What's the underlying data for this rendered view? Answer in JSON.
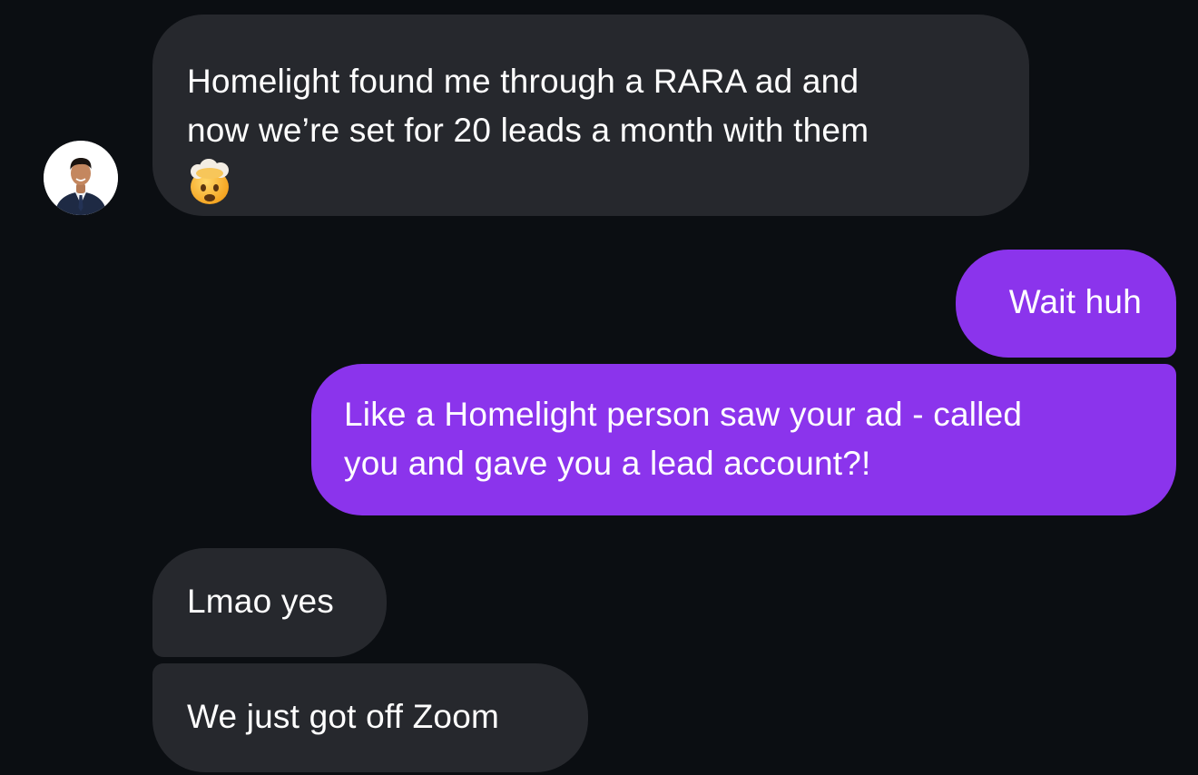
{
  "thread": {
    "messages": [
      {
        "direction": "incoming",
        "lines": [
          "Homelight found me through a RARA ad and",
          "now we’re set for 20 leads a month with them"
        ],
        "emoji": "exploding-head"
      },
      {
        "direction": "outgoing",
        "lines": [
          "Wait huh"
        ]
      },
      {
        "direction": "outgoing",
        "lines": [
          "Like a Homelight person saw your ad - called",
          "you and gave you a lead account?!"
        ]
      },
      {
        "direction": "incoming",
        "lines": [
          "Lmao yes"
        ]
      },
      {
        "direction": "incoming",
        "lines": [
          "We just got off Zoom"
        ]
      }
    ]
  },
  "avatar": {
    "icon": "person-avatar"
  },
  "colors": {
    "background": "#0b0e12",
    "incoming_bubble": "#26282d",
    "outgoing_bubble": "#8b34ec",
    "text": "#ffffff"
  }
}
